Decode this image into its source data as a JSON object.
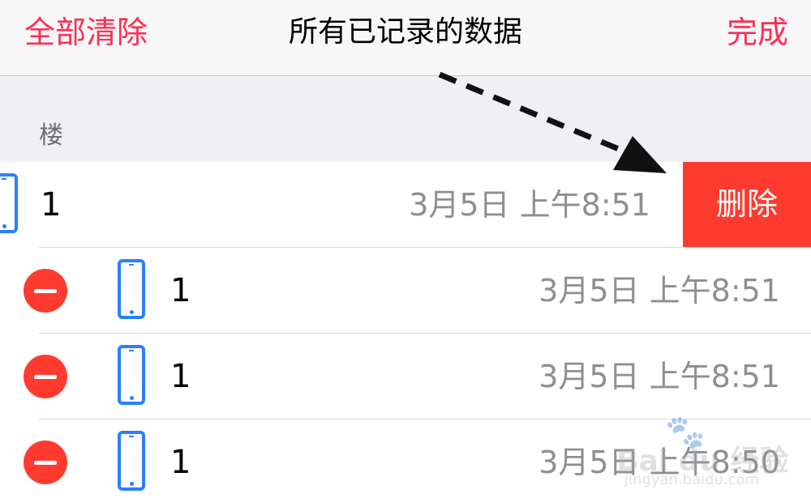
{
  "navbar": {
    "left_label": "全部清除",
    "title": "所有已记录的数据",
    "right_label": "完成"
  },
  "section": {
    "title": "楼"
  },
  "rows": [
    {
      "value": "1",
      "time": "3月5日 上午8:51",
      "swiped": true
    },
    {
      "value": "1",
      "time": "3月5日 上午8:51",
      "swiped": false
    },
    {
      "value": "1",
      "time": "3月5日 上午8:51",
      "swiped": false
    },
    {
      "value": "1",
      "time": "3月5日 上午8:50",
      "swiped": false
    }
  ],
  "delete_label": "删除",
  "icons": {
    "row_icon": "phone-icon",
    "edit_icon": "minus-circle-icon"
  },
  "colors": {
    "accent": "#ff2d55",
    "destructive": "#ff3b30",
    "icon_blue": "#2b7fff",
    "secondary_text": "#8e8e93"
  },
  "watermark": {
    "brand": "Bai du 经验",
    "site": "jingyan.baidu.com"
  }
}
